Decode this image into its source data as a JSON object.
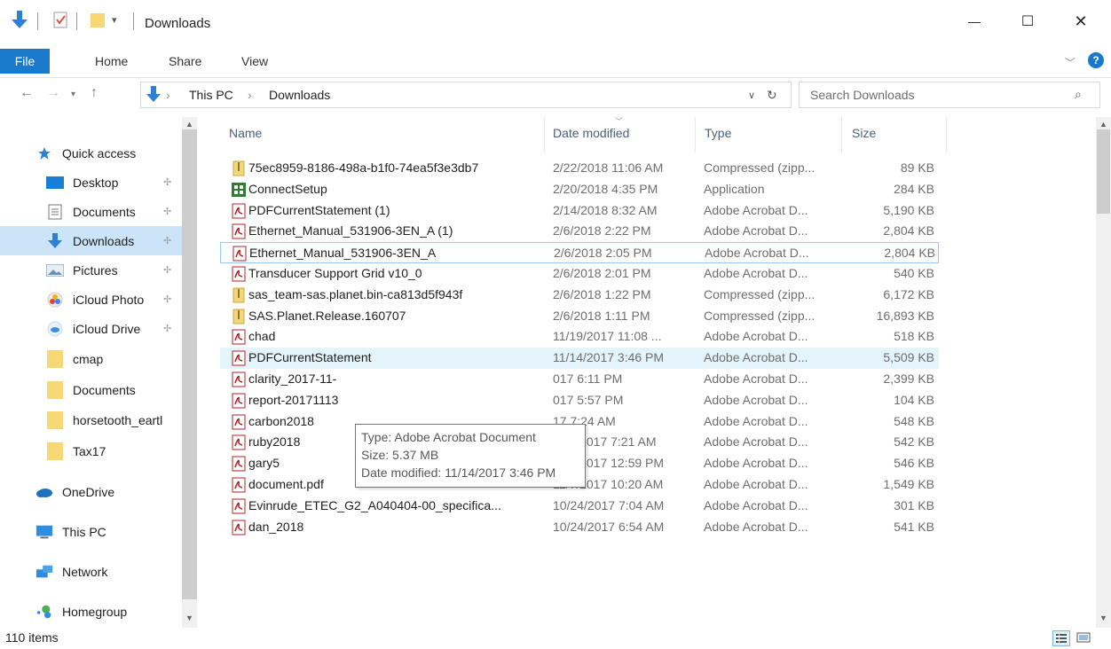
{
  "window": {
    "title": "Downloads",
    "minimize": "—",
    "maximize": "☐",
    "close": "✕"
  },
  "ribbon": {
    "tabs": [
      "File",
      "Home",
      "Share",
      "View"
    ],
    "help": "?"
  },
  "address": {
    "crumbs": [
      "This PC",
      "Downloads"
    ],
    "search_placeholder": "Search Downloads"
  },
  "nav": {
    "items": [
      {
        "label": "Quick access",
        "icon": "star-icon",
        "pinned": false
      },
      {
        "label": "Desktop",
        "icon": "desktop-icon",
        "pinned": true
      },
      {
        "label": "Documents",
        "icon": "documents-icon",
        "pinned": true
      },
      {
        "label": "Downloads",
        "icon": "downloads-icon",
        "pinned": true,
        "selected": true
      },
      {
        "label": "Pictures",
        "icon": "pictures-icon",
        "pinned": true
      },
      {
        "label": "iCloud Photo",
        "icon": "icloud-photos-icon",
        "pinned": true
      },
      {
        "label": "iCloud Drive",
        "icon": "icloud-drive-icon",
        "pinned": true
      },
      {
        "label": "cmap",
        "icon": "folder-icon",
        "pinned": false
      },
      {
        "label": "Documents",
        "icon": "folder-icon",
        "pinned": false
      },
      {
        "label": "horsetooth_eartl",
        "icon": "folder-icon",
        "pinned": false
      },
      {
        "label": "Tax17",
        "icon": "folder-icon",
        "pinned": false
      },
      {
        "label": "OneDrive",
        "icon": "onedrive-icon",
        "pinned": false
      },
      {
        "label": "This PC",
        "icon": "this-pc-icon",
        "pinned": false
      },
      {
        "label": "Network",
        "icon": "network-icon",
        "pinned": false
      },
      {
        "label": "Homegroup",
        "icon": "homegroup-icon",
        "pinned": false
      }
    ]
  },
  "columns": {
    "name": "Name",
    "date": "Date modified",
    "type": "Type",
    "size": "Size"
  },
  "files": [
    {
      "name": "75ec8959-8186-498a-b1f0-74ea5f3e3db7",
      "date": "2/22/2018 11:06 AM",
      "type": "Compressed (zipp...",
      "size": "89 KB",
      "icon": "zip-icon"
    },
    {
      "name": "ConnectSetup",
      "date": "2/20/2018 4:35 PM",
      "type": "Application",
      "size": "284 KB",
      "icon": "app-icon"
    },
    {
      "name": "PDFCurrentStatement (1)",
      "date": "2/14/2018 8:32 AM",
      "type": "Adobe Acrobat D...",
      "size": "5,190 KB",
      "icon": "pdf-icon"
    },
    {
      "name": "Ethernet_Manual_531906-3EN_A (1)",
      "date": "2/6/2018 2:22 PM",
      "type": "Adobe Acrobat D...",
      "size": "2,804 KB",
      "icon": "pdf-icon"
    },
    {
      "name": "Ethernet_Manual_531906-3EN_A",
      "date": "2/6/2018 2:05 PM",
      "type": "Adobe Acrobat D...",
      "size": "2,804 KB",
      "icon": "pdf-icon"
    },
    {
      "name": "Transducer Support Grid v10_0",
      "date": "2/6/2018 2:01 PM",
      "type": "Adobe Acrobat D...",
      "size": "540 KB",
      "icon": "pdf-icon"
    },
    {
      "name": "sas_team-sas.planet.bin-ca813d5f943f",
      "date": "2/6/2018 1:22 PM",
      "type": "Compressed (zipp...",
      "size": "6,172 KB",
      "icon": "zip-icon"
    },
    {
      "name": "SAS.Planet.Release.160707",
      "date": "2/6/2018 1:11 PM",
      "type": "Compressed (zipp...",
      "size": "16,893 KB",
      "icon": "zip-icon"
    },
    {
      "name": "chad",
      "date": "11/19/2017 11:08 ...",
      "type": "Adobe Acrobat D...",
      "size": "518 KB",
      "icon": "pdf-icon"
    },
    {
      "name": "PDFCurrentStatement",
      "date": "11/14/2017 3:46 PM",
      "type": "Adobe Acrobat D...",
      "size": "5,509 KB",
      "icon": "pdf-icon"
    },
    {
      "name": "clarity_2017-11-",
      "date": "017 6:11 PM",
      "type": "Adobe Acrobat D...",
      "size": "2,399 KB",
      "icon": "pdf-icon"
    },
    {
      "name": "report-20171113",
      "date": "017 5:57 PM",
      "type": "Adobe Acrobat D...",
      "size": "104 KB",
      "icon": "pdf-icon"
    },
    {
      "name": "carbon2018",
      "date": "17 7:24 AM",
      "type": "Adobe Acrobat D...",
      "size": "548 KB",
      "icon": "pdf-icon"
    },
    {
      "name": "ruby2018",
      "date": "11/8/2017 7:21 AM",
      "type": "Adobe Acrobat D...",
      "size": "542 KB",
      "icon": "pdf-icon"
    },
    {
      "name": "gary5",
      "date": "11/7/2017 12:59 PM",
      "type": "Adobe Acrobat D...",
      "size": "546 KB",
      "icon": "pdf-icon"
    },
    {
      "name": "document.pdf",
      "date": "11/7/2017 10:20 AM",
      "type": "Adobe Acrobat D...",
      "size": "1,549 KB",
      "icon": "pdf-icon"
    },
    {
      "name": "Evinrude_ETEC_G2_A040404-00_specifica...",
      "date": "10/24/2017 7:04 AM",
      "type": "Adobe Acrobat D...",
      "size": "301 KB",
      "icon": "pdf-icon"
    },
    {
      "name": "dan_2018",
      "date": "10/24/2017 6:54 AM",
      "type": "Adobe Acrobat D...",
      "size": "541 KB",
      "icon": "pdf-icon"
    }
  ],
  "tooltip": {
    "type": "Type: Adobe Acrobat Document",
    "size": "Size: 5.37 MB",
    "date": "Date modified: 11/14/2017 3:46 PM"
  },
  "status": {
    "count": "110 items"
  },
  "colors": {
    "accent": "#1979ca",
    "selected": "#cce4f7",
    "hover": "#e5f3fb",
    "pdf": "#b22222",
    "folder": "#f8d775"
  }
}
